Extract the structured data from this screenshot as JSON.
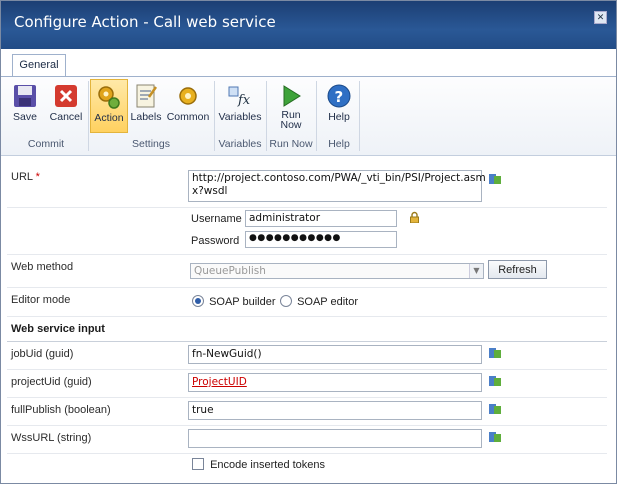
{
  "window": {
    "title": "Configure Action - Call web service"
  },
  "ribbon": {
    "tab": "General",
    "buttons": {
      "save": "Save",
      "cancel": "Cancel",
      "action": "Action",
      "labels": "Labels",
      "common": "Common",
      "variables": "Variables",
      "run_now_1": "Run",
      "run_now_2": "Now",
      "help": "Help"
    },
    "groups": {
      "commit": "Commit",
      "settings": "Settings",
      "variables": "Variables",
      "run_now": "Run Now",
      "help": "Help"
    }
  },
  "form": {
    "url_label": "URL",
    "url_required": "*",
    "url_value_1": "http://project.contoso.com/PWA/_vti_bin/PSI/Project.asm",
    "url_value_2": "x?wsdl",
    "username_label": "Username",
    "username_value": "administrator",
    "password_label": "Password",
    "password_value": "●●●●●●●●●●●",
    "web_method_label": "Web method",
    "web_method_value": "QueuePublish",
    "refresh_label": "Refresh",
    "editor_mode_label": "Editor mode",
    "soap_builder": "SOAP builder",
    "soap_editor": "SOAP editor",
    "section_title": "Web service input",
    "params": [
      {
        "label": "jobUid (guid)",
        "value": "fn-NewGuid()"
      },
      {
        "label": "projectUid (guid)",
        "value": "ProjectUID"
      },
      {
        "label": "fullPublish (boolean)",
        "value": "true"
      },
      {
        "label": "WssURL (string)",
        "value": ""
      }
    ],
    "encode_label": "Encode inserted tokens"
  },
  "colors": {
    "title_bar": "#2a5896",
    "accent": "#ffd160",
    "token_link": "#cc0000"
  }
}
